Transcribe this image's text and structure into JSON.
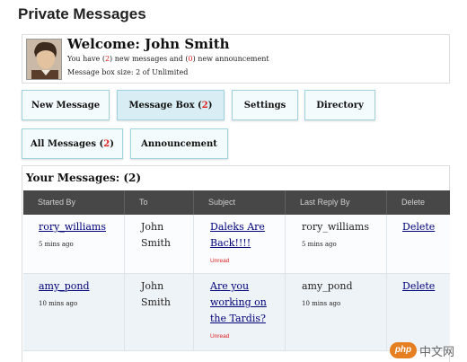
{
  "page": {
    "title": "Private Messages"
  },
  "welcome": {
    "title": "Welcome: John Smith",
    "line1_prefix": "You have (",
    "new_messages": "2",
    "line1_mid": ") new messages and (",
    "new_announcements": "0",
    "line1_suffix": ") new announcement",
    "line2": "Message box size: 2 of Unlimited"
  },
  "nav": {
    "new_message": "New Message",
    "message_box": "Message Box (",
    "message_box_count": "2",
    "settings": "Settings",
    "directory": "Directory",
    "all_messages": "All Messages (",
    "all_messages_count": "2",
    "announcement": "Announcement",
    "close_paren": ")"
  },
  "messages": {
    "title": "Your Messages: (2)",
    "columns": [
      "Started By",
      "To",
      "Subject",
      "Last Reply By",
      "Delete"
    ],
    "rows": [
      {
        "started_by": "rory_williams",
        "started_time": "5 mins ago",
        "to_line1": "John",
        "to_line2": "Smith",
        "subject_lines": [
          "Daleks Are",
          "Back!!!!"
        ],
        "status": "Unread",
        "last_reply_by": "rory_williams",
        "last_reply_time": "5 mins ago",
        "delete": "Delete"
      },
      {
        "started_by": "amy_pond",
        "started_time": "10 mins ago",
        "to_line1": "John",
        "to_line2": "Smith",
        "subject_lines": [
          "Are you",
          "working on",
          "the Tardis?"
        ],
        "status": "Unread",
        "last_reply_by": "amy_pond",
        "last_reply_time": "10 mins ago",
        "delete": "Delete"
      }
    ]
  },
  "watermark": {
    "logo": "php",
    "text": "中文网"
  }
}
